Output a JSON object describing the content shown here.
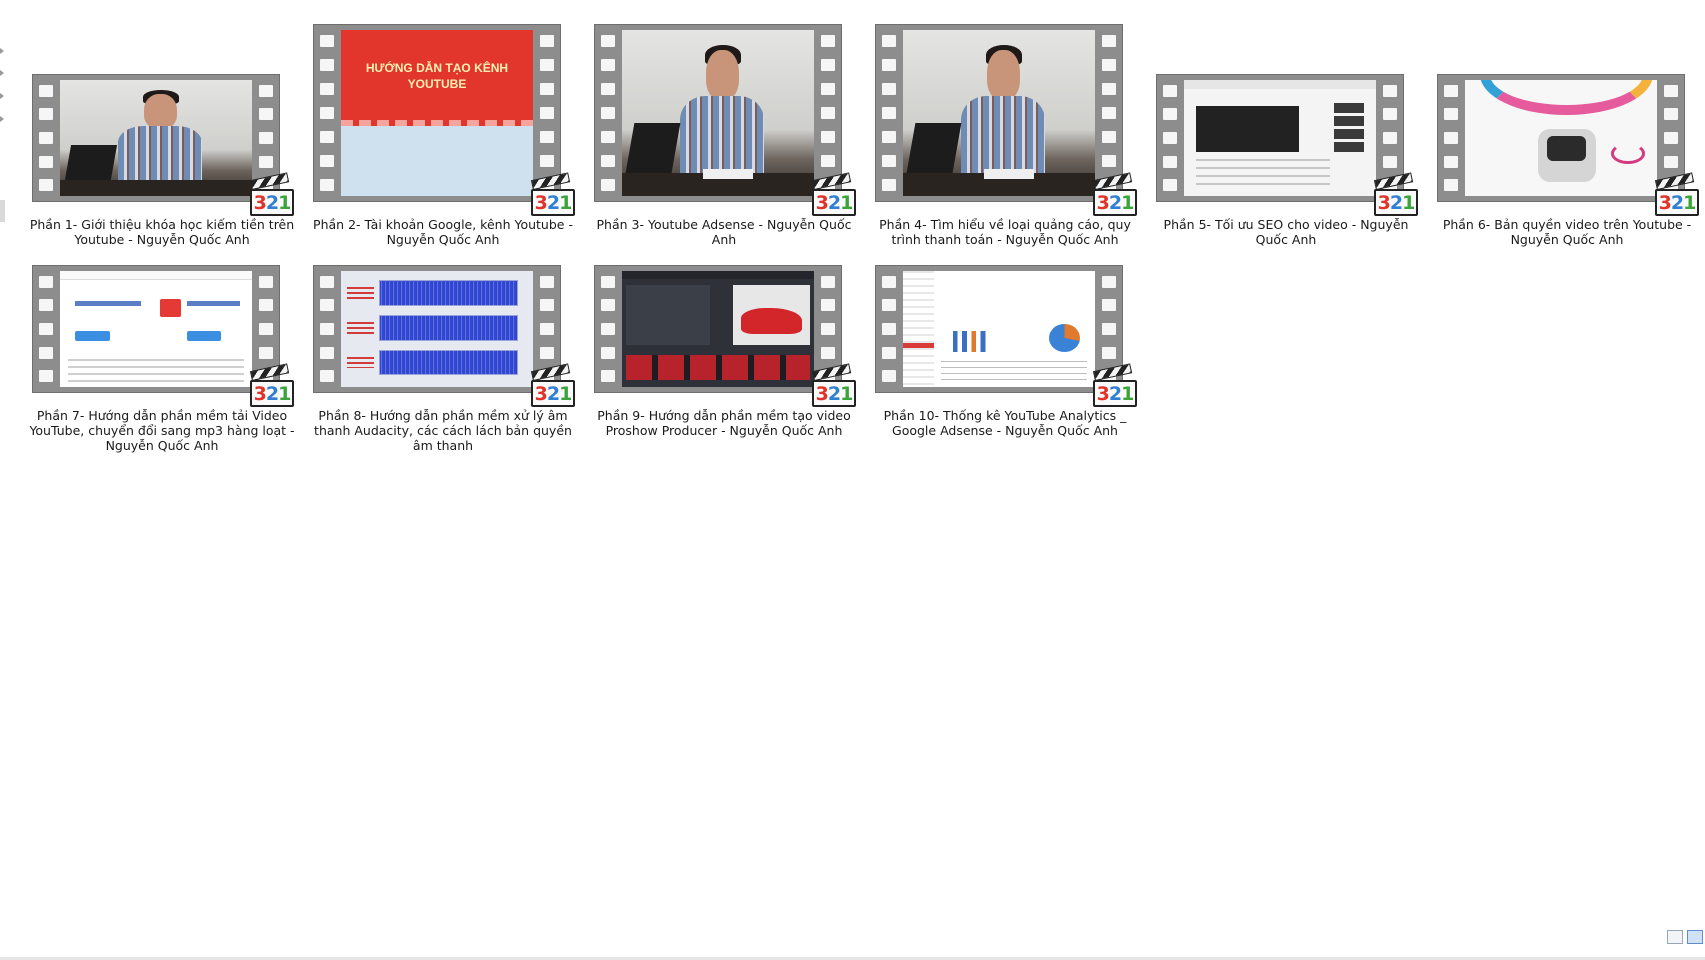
{
  "window": {
    "view_mode": "large-icons"
  },
  "files": [
    {
      "name": "Phần 1- Giới thiệu khóa học kiếm tiền trên Youtube - Nguyễn Quốc Anh",
      "thumbnail": "presenter",
      "badge": "321"
    },
    {
      "name": "Phần 2- Tài khoản Google, kênh Youtube - Nguyễn Quốc Anh",
      "thumbnail": "red-title",
      "thumbnail_text": "HƯỚNG DẪN TẠO KÊNH YOUTUBE",
      "badge": "321"
    },
    {
      "name": "Phần 3- Youtube Adsense - Nguyễn Quốc Anh",
      "thumbnail": "presenter",
      "badge": "321"
    },
    {
      "name": "Phần 4- Tìm hiểu về loại quảng cáo, quy trình thanh toán - Nguyễn Quốc Anh",
      "thumbnail": "presenter",
      "badge": "321"
    },
    {
      "name": "Phần 5- Tối ưu SEO cho video - Nguyễn Quốc Anh",
      "thumbnail": "youtube-page",
      "badge": "321"
    },
    {
      "name": "Phần 6- Bản quyền video trên Youtube - Nguyễn Quốc Anh",
      "thumbnail": "robot",
      "badge": "321"
    },
    {
      "name": "Phần 7- Hướng dẫn phần mềm tải Video YouTube, chuyển đổi sang mp3 hàng loạt - Nguyễn Quốc Anh",
      "thumbnail": "converter-site",
      "badge": "321"
    },
    {
      "name": "Phần 8- Hướng dẫn phần mềm xử lý âm thanh Audacity, các cách lách bản quyền âm thanh",
      "thumbnail": "audio-waveform",
      "badge": "321"
    },
    {
      "name": "Phần 9- Hướng dẫn phần mềm tạo video Proshow Producer - Nguyễn Quốc Anh",
      "thumbnail": "proshow",
      "badge": "321"
    },
    {
      "name": "Phần 10- Thống kê YouTube Analytics _ Google Adsense - Nguyễn Quốc Anh",
      "thumbnail": "analytics",
      "badge": "321"
    }
  ],
  "icons": {
    "file_type": "media-player-classic-321-icon",
    "view_details": "details-view-icon",
    "view_large": "large-icons-view-icon"
  },
  "colors": {
    "background": "#ffffff",
    "film_frame": "#8d8d8d",
    "badge_3": "#e0342a",
    "badge_2": "#2f7fd2",
    "badge_1": "#3aa33a"
  }
}
